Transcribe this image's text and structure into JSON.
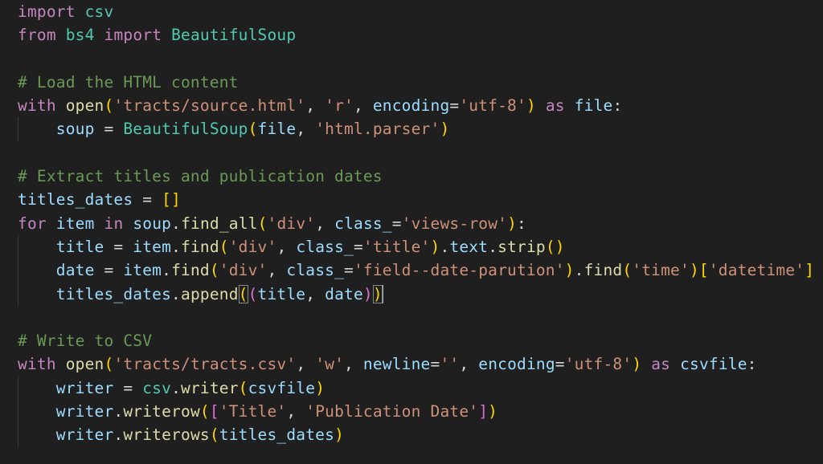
{
  "editor": {
    "theme": "dark",
    "colors": {
      "background": "#1f1f1f",
      "keyword": "#c586c0",
      "module": "#4ec9b0",
      "function": "#dcdcaa",
      "variable": "#9cdcfe",
      "string": "#ce9178",
      "comment": "#6a9955",
      "bracket_level1": "#ffd700",
      "bracket_level2": "#da70d6"
    },
    "cursor": {
      "line": 13,
      "after_token": "b1-close"
    },
    "lines": [
      [
        {
          "t": "import",
          "c": "kw"
        },
        {
          "t": " ",
          "c": "op"
        },
        {
          "t": "csv",
          "c": "mod"
        }
      ],
      [
        {
          "t": "from",
          "c": "kw"
        },
        {
          "t": " ",
          "c": "op"
        },
        {
          "t": "bs4",
          "c": "mod"
        },
        {
          "t": " ",
          "c": "op"
        },
        {
          "t": "import",
          "c": "kw"
        },
        {
          "t": " ",
          "c": "op"
        },
        {
          "t": "BeautifulSoup",
          "c": "mod"
        }
      ],
      [],
      [
        {
          "t": "# Load the HTML content",
          "c": "cm"
        }
      ],
      [
        {
          "t": "with",
          "c": "kw"
        },
        {
          "t": " ",
          "c": "op"
        },
        {
          "t": "open",
          "c": "fn"
        },
        {
          "t": "(",
          "c": "b1"
        },
        {
          "t": "'tracts/source.html'",
          "c": "str"
        },
        {
          "t": ", ",
          "c": "op"
        },
        {
          "t": "'r'",
          "c": "str"
        },
        {
          "t": ", ",
          "c": "op"
        },
        {
          "t": "encoding",
          "c": "var"
        },
        {
          "t": "=",
          "c": "op"
        },
        {
          "t": "'utf-8'",
          "c": "str"
        },
        {
          "t": ")",
          "c": "b1"
        },
        {
          "t": " ",
          "c": "op"
        },
        {
          "t": "as",
          "c": "kw"
        },
        {
          "t": " ",
          "c": "op"
        },
        {
          "t": "file",
          "c": "var"
        },
        {
          "t": ":",
          "c": "op"
        }
      ],
      [
        {
          "t": "    ",
          "c": "op",
          "guide": true
        },
        {
          "t": "soup",
          "c": "var"
        },
        {
          "t": " = ",
          "c": "op"
        },
        {
          "t": "BeautifulSoup",
          "c": "mod"
        },
        {
          "t": "(",
          "c": "b1"
        },
        {
          "t": "file",
          "c": "var"
        },
        {
          "t": ", ",
          "c": "op"
        },
        {
          "t": "'html.parser'",
          "c": "str"
        },
        {
          "t": ")",
          "c": "b1"
        }
      ],
      [],
      [
        {
          "t": "# Extract titles and publication dates",
          "c": "cm"
        }
      ],
      [
        {
          "t": "titles_dates",
          "c": "var"
        },
        {
          "t": " = ",
          "c": "op"
        },
        {
          "t": "[]",
          "c": "b1"
        }
      ],
      [
        {
          "t": "for",
          "c": "kw"
        },
        {
          "t": " ",
          "c": "op"
        },
        {
          "t": "item",
          "c": "var"
        },
        {
          "t": " ",
          "c": "op"
        },
        {
          "t": "in",
          "c": "kw"
        },
        {
          "t": " ",
          "c": "op"
        },
        {
          "t": "soup",
          "c": "var"
        },
        {
          "t": ".",
          "c": "op"
        },
        {
          "t": "find_all",
          "c": "fn"
        },
        {
          "t": "(",
          "c": "b1"
        },
        {
          "t": "'div'",
          "c": "str"
        },
        {
          "t": ", ",
          "c": "op"
        },
        {
          "t": "class_",
          "c": "var"
        },
        {
          "t": "=",
          "c": "op"
        },
        {
          "t": "'views-row'",
          "c": "str"
        },
        {
          "t": ")",
          "c": "b1"
        },
        {
          "t": ":",
          "c": "op"
        }
      ],
      [
        {
          "t": "    ",
          "c": "op",
          "guide": true
        },
        {
          "t": "title",
          "c": "var"
        },
        {
          "t": " = ",
          "c": "op"
        },
        {
          "t": "item",
          "c": "var"
        },
        {
          "t": ".",
          "c": "op"
        },
        {
          "t": "find",
          "c": "fn"
        },
        {
          "t": "(",
          "c": "b1"
        },
        {
          "t": "'div'",
          "c": "str"
        },
        {
          "t": ", ",
          "c": "op"
        },
        {
          "t": "class_",
          "c": "var"
        },
        {
          "t": "=",
          "c": "op"
        },
        {
          "t": "'title'",
          "c": "str"
        },
        {
          "t": ")",
          "c": "b1"
        },
        {
          "t": ".",
          "c": "op"
        },
        {
          "t": "text",
          "c": "var"
        },
        {
          "t": ".",
          "c": "op"
        },
        {
          "t": "strip",
          "c": "fn"
        },
        {
          "t": "()",
          "c": "b1"
        }
      ],
      [
        {
          "t": "    ",
          "c": "op",
          "guide": true
        },
        {
          "t": "date",
          "c": "var"
        },
        {
          "t": " = ",
          "c": "op"
        },
        {
          "t": "item",
          "c": "var"
        },
        {
          "t": ".",
          "c": "op"
        },
        {
          "t": "find",
          "c": "fn"
        },
        {
          "t": "(",
          "c": "b1"
        },
        {
          "t": "'div'",
          "c": "str"
        },
        {
          "t": ", ",
          "c": "op"
        },
        {
          "t": "class_",
          "c": "var"
        },
        {
          "t": "=",
          "c": "op"
        },
        {
          "t": "'field--date-parution'",
          "c": "str"
        },
        {
          "t": ")",
          "c": "b1"
        },
        {
          "t": ".",
          "c": "op"
        },
        {
          "t": "find",
          "c": "fn"
        },
        {
          "t": "(",
          "c": "b1"
        },
        {
          "t": "'time'",
          "c": "str"
        },
        {
          "t": ")",
          "c": "b1"
        },
        {
          "t": "[",
          "c": "b1"
        },
        {
          "t": "'datetime'",
          "c": "str"
        },
        {
          "t": "]",
          "c": "b1"
        }
      ],
      [
        {
          "t": "    ",
          "c": "op",
          "guide": true
        },
        {
          "t": "titles_dates",
          "c": "var"
        },
        {
          "t": ".",
          "c": "op"
        },
        {
          "t": "append",
          "c": "fn"
        },
        {
          "t": "(",
          "c": "b1",
          "m": true
        },
        {
          "t": "(",
          "c": "b2"
        },
        {
          "t": "title",
          "c": "var"
        },
        {
          "t": ", ",
          "c": "op"
        },
        {
          "t": "date",
          "c": "var"
        },
        {
          "t": ")",
          "c": "b2"
        },
        {
          "t": ")",
          "c": "b1",
          "m": true,
          "cursor": true
        }
      ],
      [],
      [
        {
          "t": "# Write to CSV",
          "c": "cm"
        }
      ],
      [
        {
          "t": "with",
          "c": "kw"
        },
        {
          "t": " ",
          "c": "op"
        },
        {
          "t": "open",
          "c": "fn"
        },
        {
          "t": "(",
          "c": "b1"
        },
        {
          "t": "'tracts/tracts.csv'",
          "c": "str"
        },
        {
          "t": ", ",
          "c": "op"
        },
        {
          "t": "'w'",
          "c": "str"
        },
        {
          "t": ", ",
          "c": "op"
        },
        {
          "t": "newline",
          "c": "var"
        },
        {
          "t": "=",
          "c": "op"
        },
        {
          "t": "''",
          "c": "str"
        },
        {
          "t": ", ",
          "c": "op"
        },
        {
          "t": "encoding",
          "c": "var"
        },
        {
          "t": "=",
          "c": "op"
        },
        {
          "t": "'utf-8'",
          "c": "str"
        },
        {
          "t": ")",
          "c": "b1"
        },
        {
          "t": " ",
          "c": "op"
        },
        {
          "t": "as",
          "c": "kw"
        },
        {
          "t": " ",
          "c": "op"
        },
        {
          "t": "csvfile",
          "c": "var"
        },
        {
          "t": ":",
          "c": "op"
        }
      ],
      [
        {
          "t": "    ",
          "c": "op",
          "guide": true
        },
        {
          "t": "writer",
          "c": "var"
        },
        {
          "t": " = ",
          "c": "op"
        },
        {
          "t": "csv",
          "c": "mod"
        },
        {
          "t": ".",
          "c": "op"
        },
        {
          "t": "writer",
          "c": "fn"
        },
        {
          "t": "(",
          "c": "b1"
        },
        {
          "t": "csvfile",
          "c": "var"
        },
        {
          "t": ")",
          "c": "b1"
        }
      ],
      [
        {
          "t": "    ",
          "c": "op",
          "guide": true
        },
        {
          "t": "writer",
          "c": "var"
        },
        {
          "t": ".",
          "c": "op"
        },
        {
          "t": "writerow",
          "c": "fn"
        },
        {
          "t": "(",
          "c": "b1"
        },
        {
          "t": "[",
          "c": "b2"
        },
        {
          "t": "'Title'",
          "c": "str"
        },
        {
          "t": ", ",
          "c": "op"
        },
        {
          "t": "'Publication Date'",
          "c": "str"
        },
        {
          "t": "]",
          "c": "b2"
        },
        {
          "t": ")",
          "c": "b1"
        }
      ],
      [
        {
          "t": "    ",
          "c": "op",
          "guide": true
        },
        {
          "t": "writer",
          "c": "var"
        },
        {
          "t": ".",
          "c": "op"
        },
        {
          "t": "writerows",
          "c": "fn"
        },
        {
          "t": "(",
          "c": "b1"
        },
        {
          "t": "titles_dates",
          "c": "var"
        },
        {
          "t": ")",
          "c": "b1"
        }
      ]
    ]
  }
}
